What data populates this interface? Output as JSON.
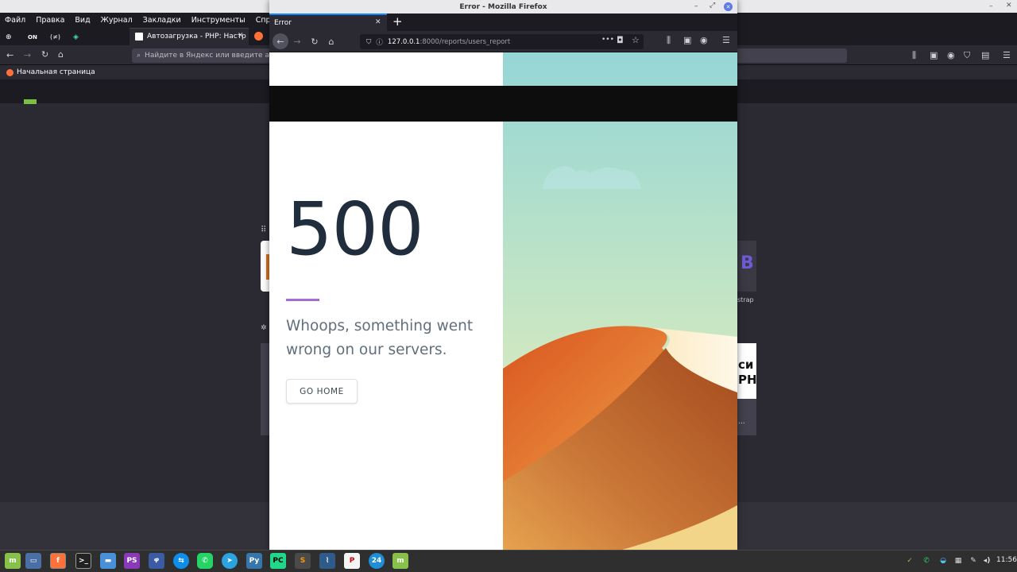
{
  "background_browser": {
    "menu": [
      "Файл",
      "Правка",
      "Вид",
      "Журнал",
      "Закладки",
      "Инструменты",
      "Справка"
    ],
    "tabs": [
      {
        "label": "ON"
      },
      {
        "label": "(≠)"
      },
      {
        "label": "Автозагрузка - PHP: Настр"
      }
    ],
    "url_placeholder": "Найдите в Яндекс или введите адре",
    "bookmark": "Начальная страница",
    "side_label": "strap",
    "side_card_text_1": "си",
    "side_card_text_2": "PH",
    "side_card_text_3": "..."
  },
  "window": {
    "title": "Error - Mozilla Firefox",
    "tab_label": "Error",
    "new_tab": "+",
    "url_host": "127.0.0.1",
    "url_path": ":8000/reports/users_report",
    "url_menu": "•••"
  },
  "error_page": {
    "code": "500",
    "message": "Whoops, something went wrong on our servers.",
    "button": "GO HOME"
  },
  "taskbar": {
    "clock": "11:56",
    "badge": "24"
  },
  "colors": {
    "accent": "#a56cd8",
    "sky_top": "#95d6d6",
    "dune": "#e07a30"
  }
}
